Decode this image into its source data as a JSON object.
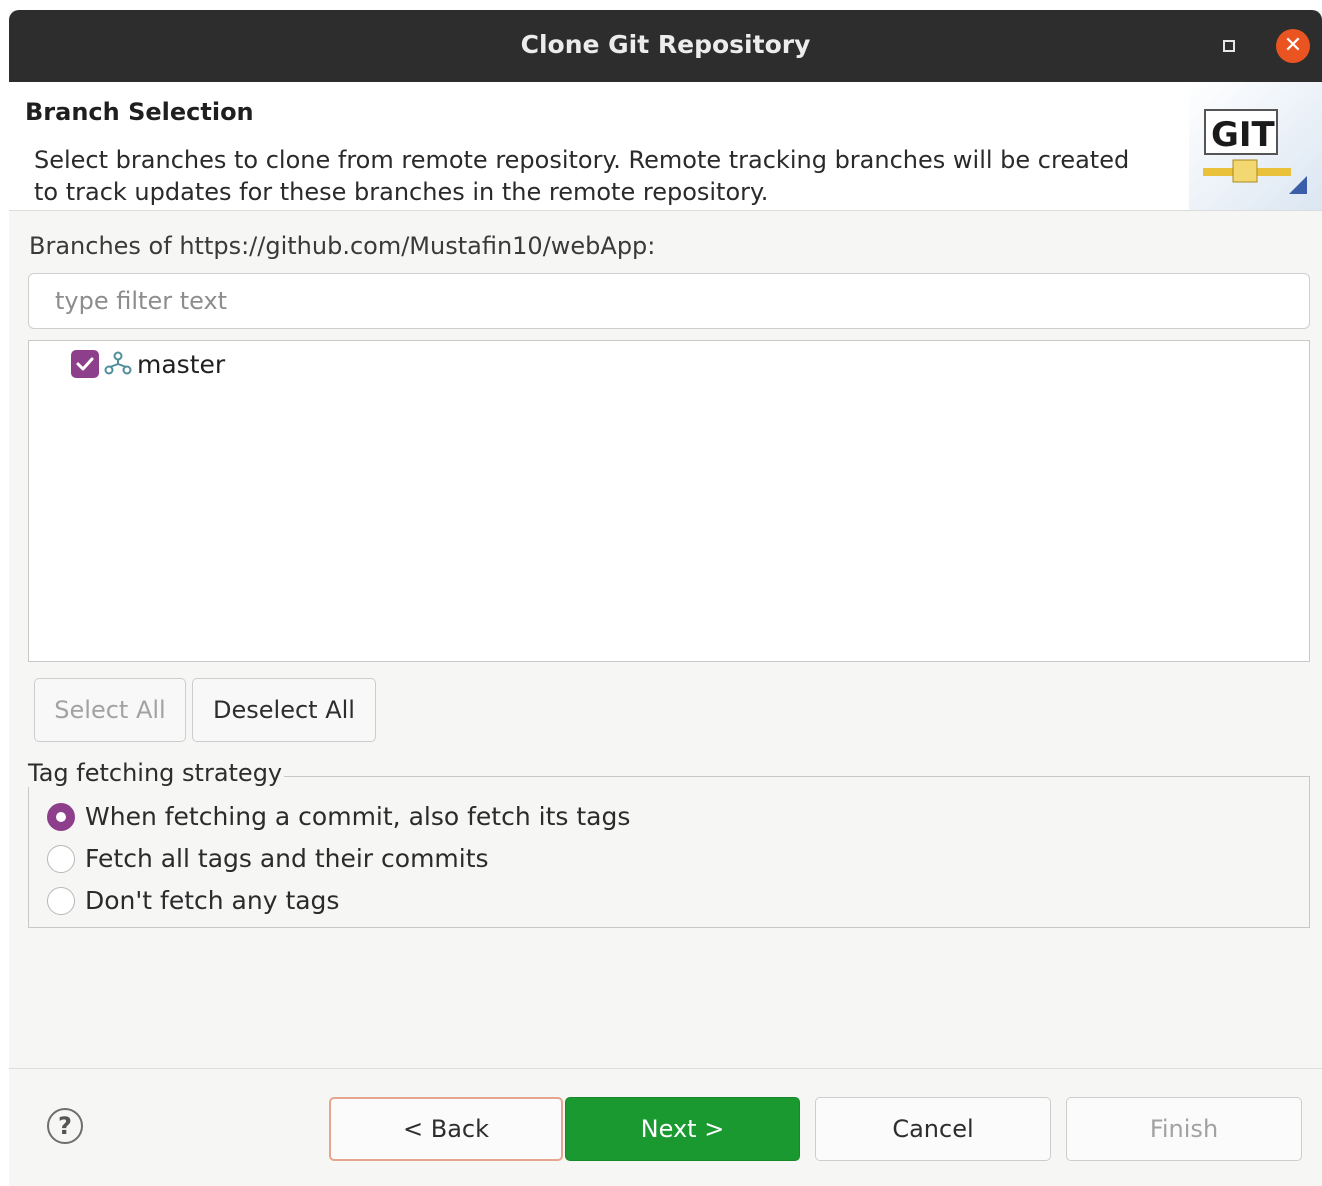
{
  "window": {
    "title": "Clone Git Repository",
    "close_glyph": "✕",
    "close_color": "#e95420"
  },
  "header": {
    "title": "Branch Selection",
    "description": "Select branches to clone from remote repository. Remote tracking branches will be created to track updates for these branches in the remote repository.",
    "logo_text": "GIT"
  },
  "branches": {
    "label": "Branches of https://github.com/Mustafin10/webApp:",
    "filter_placeholder": "type filter text",
    "items": [
      {
        "name": "master",
        "checked": true,
        "icon": "branch-icon"
      }
    ],
    "select_all": "Select All",
    "deselect_all": "Deselect All"
  },
  "tag_strategy": {
    "legend": "Tag fetching strategy",
    "options": [
      {
        "label": "When fetching a commit, also fetch its tags",
        "selected": true
      },
      {
        "label": "Fetch all tags and their commits",
        "selected": false
      },
      {
        "label": "Don't fetch any tags",
        "selected": false
      }
    ]
  },
  "footer": {
    "help_glyph": "?",
    "back": "< Back",
    "next": "Next >",
    "cancel": "Cancel",
    "finish": "Finish",
    "accent_color": "#1a9930",
    "check_color": "#8e3f8c"
  }
}
